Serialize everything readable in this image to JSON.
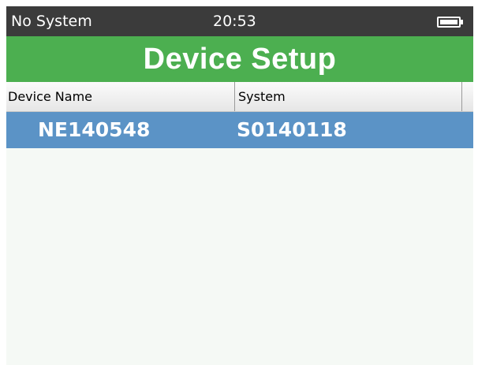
{
  "status_bar": {
    "system_status": "No System",
    "time": "20:53",
    "battery_icon": "battery-icon"
  },
  "title": "Device Setup",
  "table": {
    "columns": [
      "Device Name",
      "System"
    ],
    "rows": [
      {
        "device_name": "NE140548",
        "system": "S0140118",
        "selected": true
      }
    ]
  },
  "colors": {
    "status_bar_bg": "#3b3b3b",
    "title_bar_bg": "#4caf50",
    "selected_row_bg": "#5b93c6",
    "content_bg": "#f5f9f5"
  }
}
